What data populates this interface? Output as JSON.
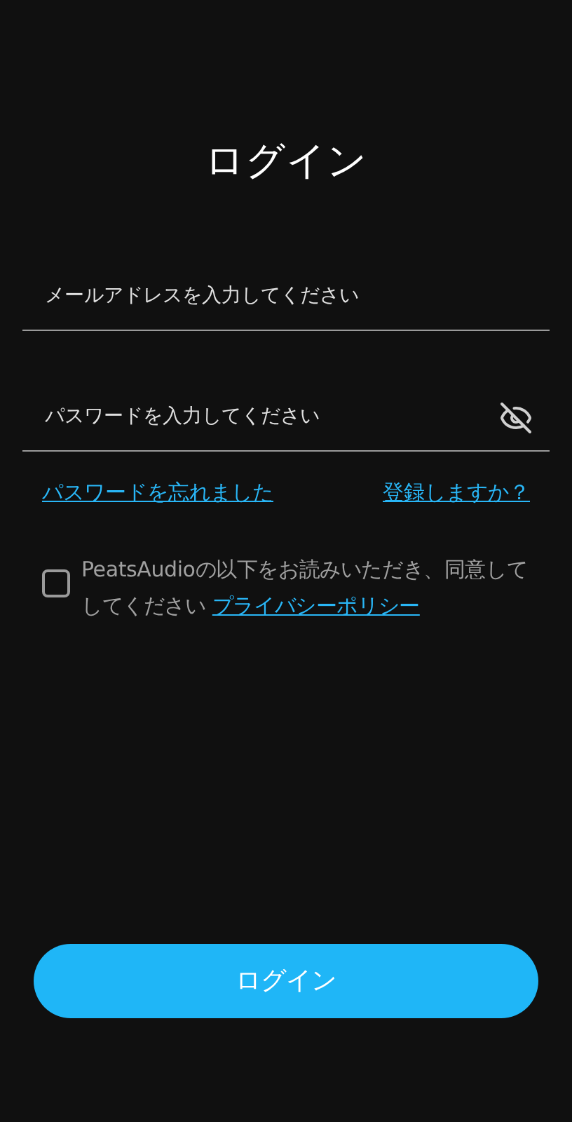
{
  "title": "ログイン",
  "email": {
    "placeholder": "メールアドレスを入力してください"
  },
  "password": {
    "placeholder": "パスワードを入力してください",
    "visible": false
  },
  "links": {
    "forgot": "パスワードを忘れました",
    "register": "登録しますか？"
  },
  "agreement": {
    "checked": false,
    "text": "PeatsAudioの以下をお読みいただき、同意してしてください",
    "link": "プライバシーポリシー"
  },
  "button": "ログイン"
}
